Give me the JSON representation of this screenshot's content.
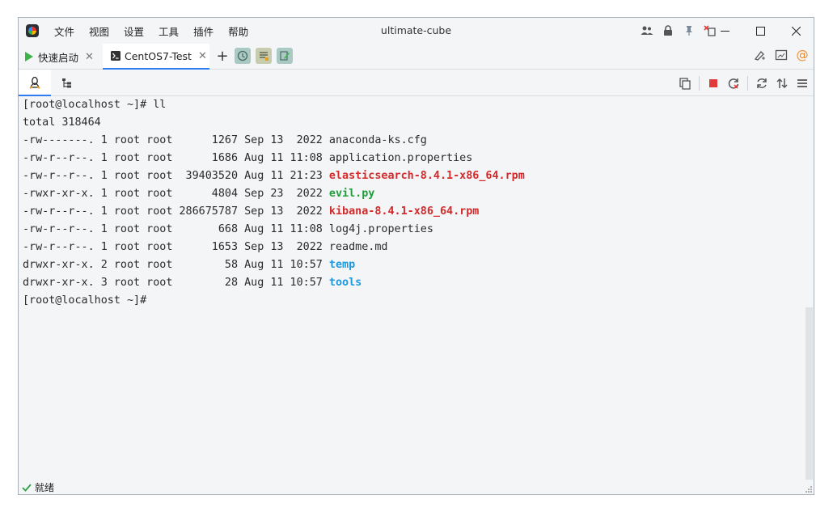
{
  "window": {
    "title": "ultimate-cube"
  },
  "menu": [
    "文件",
    "视图",
    "设置",
    "工具",
    "插件",
    "帮助"
  ],
  "tabs": {
    "quick_start": "快速启动",
    "active": "CentOS7-Test"
  },
  "terminal": {
    "lines": [
      [
        {
          "t": "[root@localhost ~]# ll"
        }
      ],
      [
        {
          "t": "total 318464"
        }
      ],
      [
        {
          "t": "-rw-------. 1 root root      1267 Sep 13  2022 "
        },
        {
          "t": "anaconda-ks.cfg"
        }
      ],
      [
        {
          "t": "-rw-r--r--. 1 root root      1686 Aug 11 11:08 "
        },
        {
          "t": "application.properties"
        }
      ],
      [
        {
          "t": "-rw-r--r--. 1 root root  39403520 Aug 11 21:23 "
        },
        {
          "t": "elasticsearch-8.4.1-x86_64.rpm",
          "c": "red"
        }
      ],
      [
        {
          "t": "-rwxr-xr-x. 1 root root      4804 Sep 23  2022 "
        },
        {
          "t": "evil.py",
          "c": "green"
        }
      ],
      [
        {
          "t": "-rw-r--r--. 1 root root 286675787 Sep 13  2022 "
        },
        {
          "t": "kibana-8.4.1-x86_64.rpm",
          "c": "red"
        }
      ],
      [
        {
          "t": "-rw-r--r--. 1 root root       668 Aug 11 11:08 "
        },
        {
          "t": "log4j.properties"
        }
      ],
      [
        {
          "t": "-rw-r--r--. 1 root root      1653 Sep 13  2022 "
        },
        {
          "t": "readme.md"
        }
      ],
      [
        {
          "t": "drwxr-xr-x. 2 root root        58 Aug 11 10:57 "
        },
        {
          "t": "temp",
          "c": "blue"
        }
      ],
      [
        {
          "t": "drwxr-xr-x. 3 root root        28 Aug 11 10:57 "
        },
        {
          "t": "tools",
          "c": "blue"
        }
      ],
      [
        {
          "t": "[root@localhost ~]#"
        }
      ]
    ]
  },
  "status": {
    "text": "就绪"
  },
  "colors": {
    "accent": "#2d7cf0",
    "file_red": "#d42a2a",
    "file_green": "#1e9e3a",
    "dir_blue": "#1a9ae0",
    "stop_red": "#e03a3a"
  },
  "icons": [
    "app-logo",
    "users-icon",
    "lock-icon",
    "pin-icon",
    "move-window-icon",
    "minimize-icon",
    "maximize-icon",
    "close-icon",
    "play-icon",
    "terminal-icon",
    "plus-icon",
    "clock-icon",
    "list-icon",
    "edit-icon",
    "paint-icon",
    "screen-icon",
    "at-icon",
    "linux-icon",
    "tree-icon",
    "copy-icon",
    "stop-icon",
    "reconnect-icon",
    "refresh-icon",
    "transfer-icon",
    "menu-icon",
    "check-icon"
  ]
}
